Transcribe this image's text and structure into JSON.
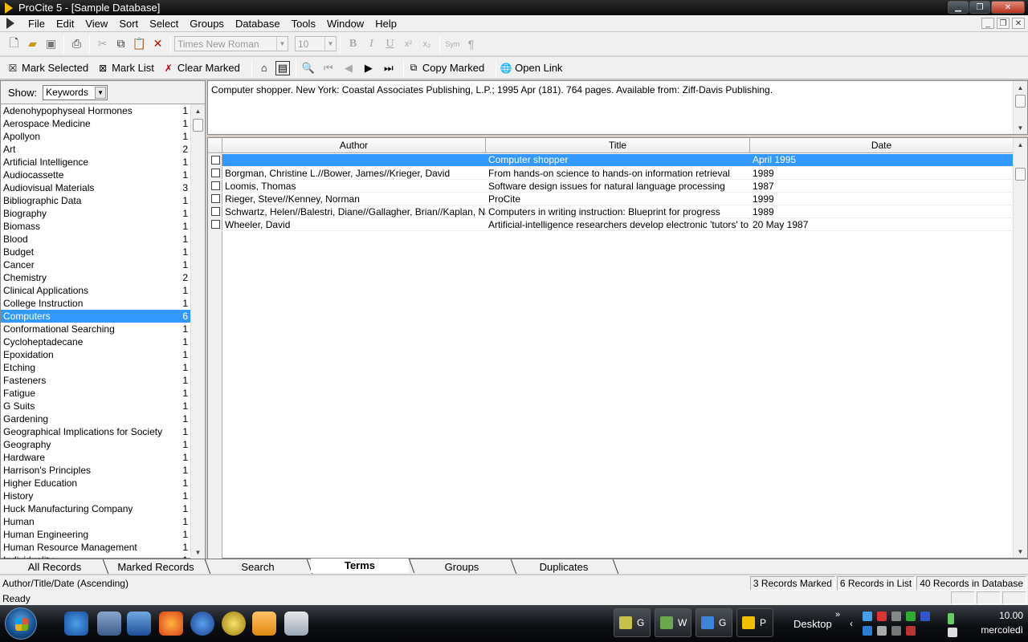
{
  "window": {
    "title": "ProCite 5 - [Sample Database]"
  },
  "menu": [
    "File",
    "Edit",
    "View",
    "Sort",
    "Select",
    "Groups",
    "Database",
    "Tools",
    "Window",
    "Help"
  ],
  "toolbar": {
    "font_name": "Times New Roman",
    "font_size": "10",
    "sym_label": "Sym",
    "para_label": "¶",
    "mark_selected": "Mark Selected",
    "mark_list": "Mark List",
    "clear_marked": "Clear Marked",
    "copy_marked": "Copy Marked",
    "open_link": "Open Link"
  },
  "left": {
    "show_label": "Show:",
    "show_value": "Keywords",
    "terms": [
      {
        "name": "Adenohypophyseal Hormones",
        "count": "1"
      },
      {
        "name": "Aerospace Medicine",
        "count": "1"
      },
      {
        "name": "Apollyon",
        "count": "1"
      },
      {
        "name": "Art",
        "count": "2"
      },
      {
        "name": "Artificial Intelligence",
        "count": "1"
      },
      {
        "name": "Audiocassette",
        "count": "1"
      },
      {
        "name": "Audiovisual Materials",
        "count": "3"
      },
      {
        "name": "Bibliographic Data",
        "count": "1"
      },
      {
        "name": "Biography",
        "count": "1"
      },
      {
        "name": "Biomass",
        "count": "1"
      },
      {
        "name": "Blood",
        "count": "1"
      },
      {
        "name": "Budget",
        "count": "1"
      },
      {
        "name": "Cancer",
        "count": "1"
      },
      {
        "name": "Chemistry",
        "count": "2"
      },
      {
        "name": "Clinical Applications",
        "count": "1"
      },
      {
        "name": "College Instruction",
        "count": "1"
      },
      {
        "name": "Computers",
        "count": "6",
        "selected": true
      },
      {
        "name": "Conformational Searching",
        "count": "1"
      },
      {
        "name": "Cycloheptadecane",
        "count": "1"
      },
      {
        "name": "Epoxidation",
        "count": "1"
      },
      {
        "name": "Etching",
        "count": "1"
      },
      {
        "name": "Fasteners",
        "count": "1"
      },
      {
        "name": "Fatigue",
        "count": "1"
      },
      {
        "name": "G Suits",
        "count": "1"
      },
      {
        "name": "Gardening",
        "count": "1"
      },
      {
        "name": "Geographical Implications for Society",
        "count": "1"
      },
      {
        "name": "Geography",
        "count": "1"
      },
      {
        "name": "Hardware",
        "count": "1"
      },
      {
        "name": "Harrison's Principles",
        "count": "1"
      },
      {
        "name": "Higher Education",
        "count": "1"
      },
      {
        "name": "History",
        "count": "1"
      },
      {
        "name": "Huck Manufacturing Company",
        "count": "1"
      },
      {
        "name": "Human",
        "count": "1"
      },
      {
        "name": "Human Engineering",
        "count": "1"
      },
      {
        "name": "Human Resource Management",
        "count": "1"
      },
      {
        "name": "Individuality",
        "count": "1"
      }
    ]
  },
  "preview": {
    "text": "Computer shopper. New York: Coastal Associates Publishing, L.P.; 1995 Apr (181). 764 pages. Available from: Ziff-Davis Publishing."
  },
  "table": {
    "columns": [
      "Author",
      "Title",
      "Date"
    ],
    "rows": [
      {
        "author": "",
        "title": "Computer shopper",
        "date": "April 1995",
        "selected": true
      },
      {
        "author": "Borgman, Christine L.//Bower, James//Krieger, David",
        "title": "From hands-on science to hands-on information retrieval",
        "date": "1989"
      },
      {
        "author": "Loomis, Thomas",
        "title": "Software design issues for natural language processing",
        "date": "1987"
      },
      {
        "author": "Rieger, Steve//Kenney, Norman",
        "title": "ProCite",
        "date": "1999"
      },
      {
        "author": "Schwartz, Helen//Balestri, Diane//Gallagher, Brian//Kaplan, Nancy",
        "title": "Computers in writing instruction: Blueprint for progress",
        "date": "1989"
      },
      {
        "author": "Wheeler, David",
        "title": "Artificial-intelligence researchers develop electronic 'tutors' to aid learning",
        "date": "20 May 1987"
      }
    ]
  },
  "tabs": [
    "All Records",
    "Marked Records",
    "Search",
    "Terms",
    "Groups",
    "Duplicates"
  ],
  "active_tab": "Terms",
  "status": {
    "sort": "Author/Title/Date (Ascending)",
    "marked": "3 Records Marked",
    "in_list": "6 Records in List",
    "in_db": "40 Records in Database",
    "ready": "Ready"
  },
  "taskbar": {
    "tasks": [
      "G",
      "W",
      "G",
      "P"
    ],
    "desktop_label": "Desktop",
    "time": "10.00",
    "day": "mercoledì"
  }
}
